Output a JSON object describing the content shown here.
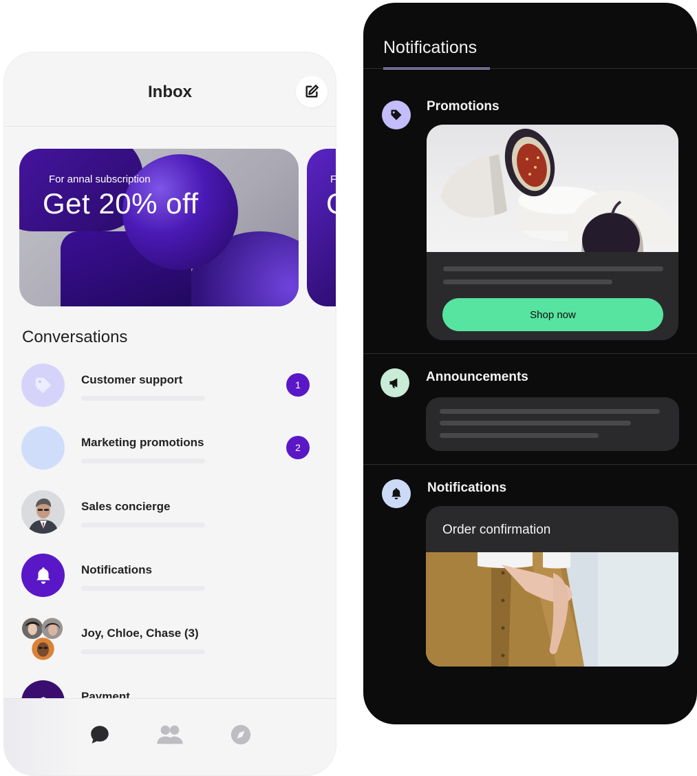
{
  "inbox": {
    "title": "Inbox",
    "compose_icon": "compose-edit-icon",
    "promo": {
      "subtitle": "For annal subscription",
      "headline": "Get 20% off",
      "next_card_subtitle_partial": "F",
      "next_card_headline_partial": "G"
    },
    "conversations_heading": "Conversations",
    "conversations": [
      {
        "name": "Customer support",
        "badge": "1",
        "avatar": "tag-icon"
      },
      {
        "name": "Marketing promotions",
        "badge": "2",
        "avatar": "blank-avatar"
      },
      {
        "name": "Sales concierge",
        "avatar": "person-photo"
      },
      {
        "name": "Notifications",
        "avatar": "bell-icon"
      },
      {
        "name": "Joy, Chloe, Chase (3)",
        "avatar": "group-photo"
      },
      {
        "name": "Payment",
        "avatar": "dollar-icon"
      }
    ],
    "tabs": [
      {
        "name": "chat-icon",
        "active": true
      },
      {
        "name": "people-icon",
        "active": false
      },
      {
        "name": "compass-icon",
        "active": false
      }
    ]
  },
  "notifications": {
    "title": "Notifications",
    "sections": {
      "promotions": {
        "title": "Promotions",
        "icon": "tag-icon",
        "button_label": "Shop now"
      },
      "announcements": {
        "title": "Announcements",
        "icon": "megaphone-icon"
      },
      "notifications": {
        "title": "Notifications",
        "icon": "bell-icon",
        "card_title": "Order confirmation"
      }
    }
  },
  "colors": {
    "accent_purple": "#5a17c7",
    "shop_green": "#57e3a0",
    "dark_bg": "#0c0c0d",
    "underline_lavender": "#bcb4f5"
  }
}
